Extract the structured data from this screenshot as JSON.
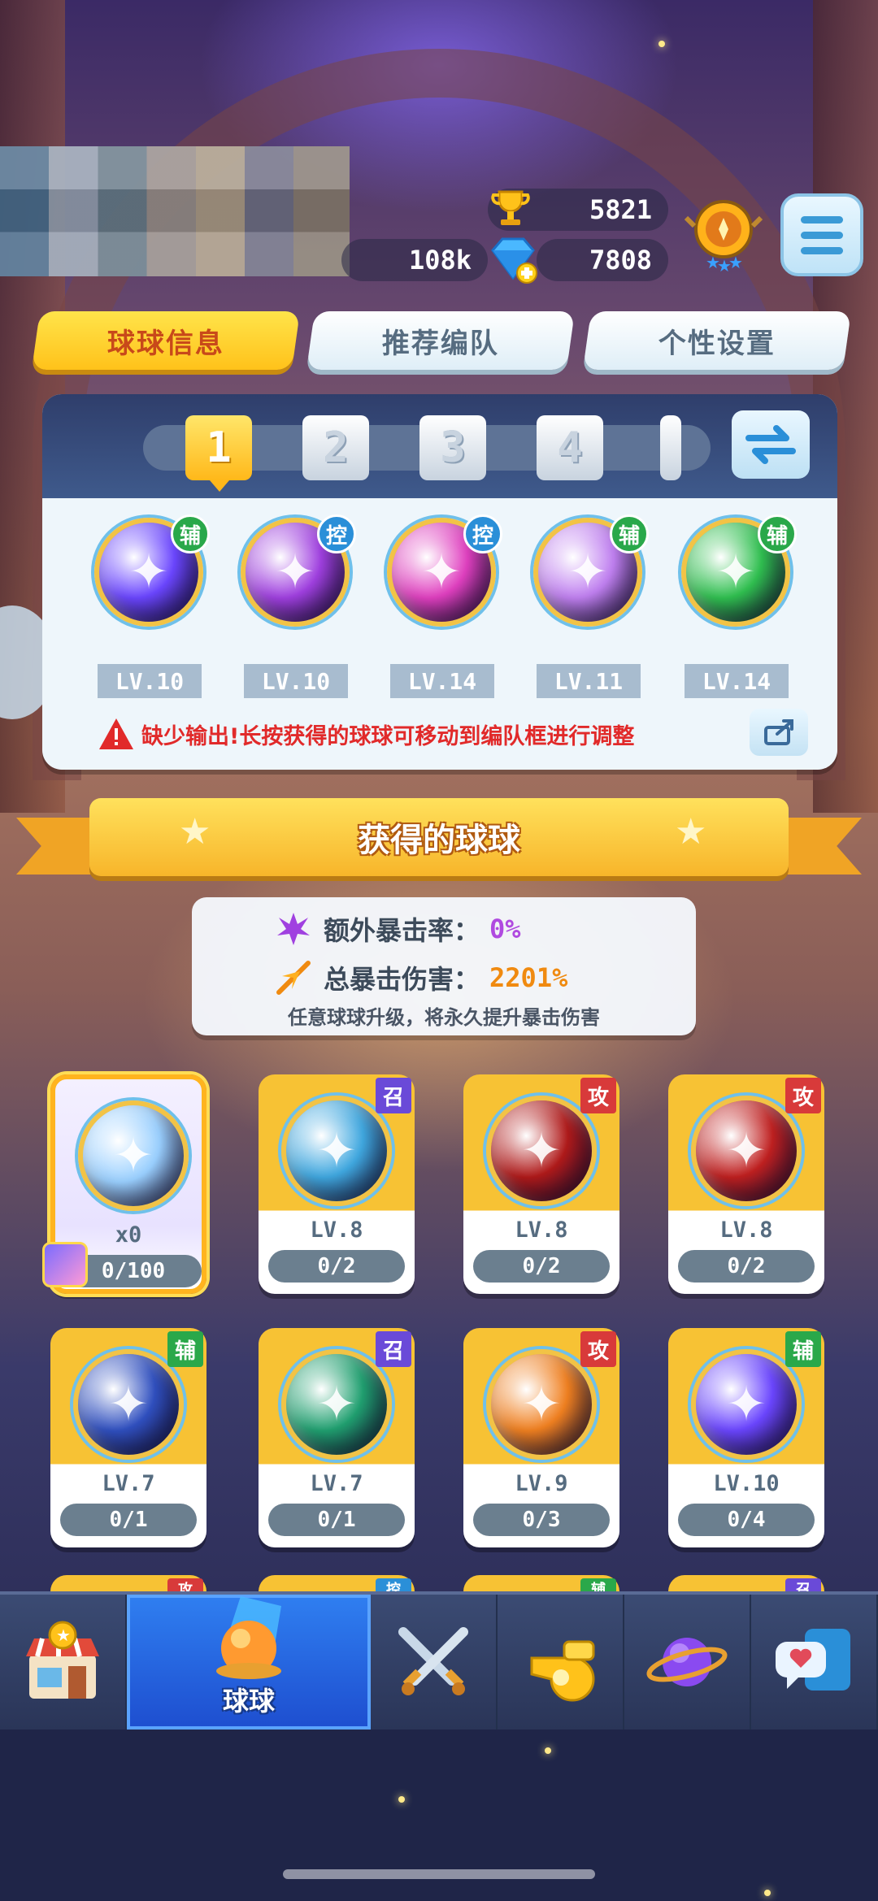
{
  "resources": {
    "trophies": "5821",
    "coins": "108k",
    "gems": "7808"
  },
  "tabs": [
    {
      "label": "球球信息",
      "active": true
    },
    {
      "label": "推荐编队",
      "active": false
    },
    {
      "label": "个性设置",
      "active": false
    }
  ],
  "team": {
    "slots": [
      "1",
      "2",
      "3",
      "4",
      ""
    ],
    "active_slot": "1",
    "balls": [
      {
        "role": "辅",
        "level": "LV.10",
        "icon": "lightning-orb-icon",
        "color": "#6b46ff"
      },
      {
        "role": "控",
        "level": "LV.10",
        "icon": "butterfly-orb-icon",
        "color": "#a040e0"
      },
      {
        "role": "控",
        "level": "LV.14",
        "icon": "sword-orb-icon",
        "color": "#e040c0"
      },
      {
        "role": "辅",
        "level": "LV.11",
        "icon": "shadow-clones-orb-icon",
        "color": "#c080f0"
      },
      {
        "role": "辅",
        "level": "LV.14",
        "icon": "star-arrow-orb-icon",
        "color": "#30c050"
      }
    ],
    "warning": "缺少输出!长按获得的球球可移动到编队框进行调整"
  },
  "section_title": "获得的球球",
  "crit": {
    "extra_rate_label": "额外暴击率：",
    "extra_rate_value": "0%",
    "total_damage_label": "总暴击伤害：",
    "total_damage_value": "2201%",
    "note": "任意球球升级，将永久提升暴击伤害"
  },
  "cards": [
    {
      "badge": "",
      "level": "x0",
      "progress": "0/100",
      "icon": "prism-orb-icon",
      "color": "#9ad0ff",
      "special": true
    },
    {
      "badge": "召",
      "level": "LV.8",
      "progress": "0/2",
      "icon": "genie-orb-icon",
      "color": "#40a8e0"
    },
    {
      "badge": "攻",
      "level": "LV.8",
      "progress": "0/2",
      "icon": "venom-orb-icon",
      "color": "#b01a1a"
    },
    {
      "badge": "攻",
      "level": "LV.8",
      "progress": "0/2",
      "icon": "trident-orb-icon",
      "color": "#c02020"
    },
    {
      "badge": "辅",
      "level": "LV.7",
      "progress": "0/1",
      "icon": "hex-planet-orb-icon",
      "color": "#3050c0"
    },
    {
      "badge": "召",
      "level": "LV.7",
      "progress": "0/1",
      "icon": "swirl-orb-icon",
      "color": "#20a070"
    },
    {
      "badge": "攻",
      "level": "LV.9",
      "progress": "0/3",
      "icon": "fire-demon-orb-icon",
      "color": "#f08020"
    },
    {
      "badge": "辅",
      "level": "LV.10",
      "progress": "0/4",
      "icon": "lightning-orb-icon",
      "color": "#6b46ff"
    }
  ],
  "peek_badges": [
    "攻",
    "控",
    "辅",
    "召"
  ],
  "badge_colors": {
    "辅": "#2aa84a",
    "控": "#2a8fd8",
    "召": "#6a4ad8",
    "攻": "#d83a3a"
  },
  "nav": [
    {
      "icon": "shop-icon",
      "label": ""
    },
    {
      "icon": "ball-icon",
      "label": "球球",
      "active": true
    },
    {
      "icon": "crossed-swords-icon",
      "label": ""
    },
    {
      "icon": "whistle-icon",
      "label": ""
    },
    {
      "icon": "planet-icon",
      "label": ""
    },
    {
      "icon": "chat-heart-icon",
      "label": ""
    }
  ]
}
